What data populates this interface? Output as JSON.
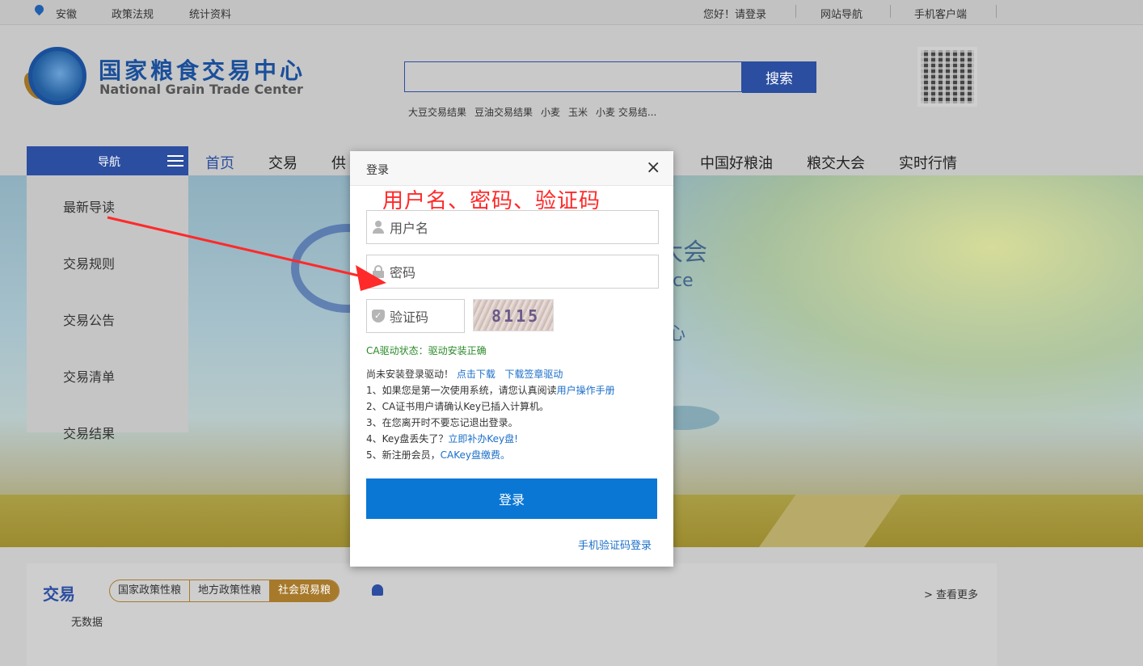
{
  "topbar": {
    "region": "安徽",
    "policy": "政策法规",
    "stats": "统计资料",
    "greeting": "您好！请登录",
    "site_nav": "网站导航",
    "mobile_client": "手机客户端"
  },
  "header": {
    "logo_cn": "国家粮食交易中心",
    "logo_en": "National Grain Trade Center",
    "search_placeholder": "",
    "search_button": "搜索",
    "hot_keywords": [
      "大豆交易结果",
      "豆油交易结果",
      "小麦",
      "玉米",
      "小麦 交易结..."
    ]
  },
  "nav": {
    "label": "导航",
    "tabs": [
      "首页",
      "交易",
      "供",
      "中国好粮油",
      "粮交大会",
      "实时行情"
    ]
  },
  "sidebar": {
    "items": [
      "最新导读",
      "交易规则",
      "交易公告",
      "交易清单",
      "交易结果"
    ]
  },
  "banner": {
    "text_fragments": [
      "大会",
      "ce",
      "心"
    ]
  },
  "bottom": {
    "title": "交易",
    "filters": [
      "国家政策性粮",
      "地方政策性粮",
      "社会贸易粮"
    ],
    "active_filter": "社会贸易粮",
    "more": "> 查看更多",
    "no_data": "无数据"
  },
  "modal": {
    "title": "登录",
    "annotation": "用户名、密码、验证码",
    "username_placeholder": "用户名",
    "password_placeholder": "密码",
    "captcha_placeholder": "验证码",
    "captcha_text": "8115",
    "ca_status": "CA驱动状态：驱动安装正确",
    "driver_prefix": "尚未安装登录驱动！",
    "driver_link1": "点击下载",
    "driver_link2": "下载签章驱动",
    "line1_text": "1、如果您是第一次使用系统，请您认真阅读",
    "line1_link": "用户操作手册",
    "line2": "2、CA证书用户请确认Key已插入计算机。",
    "line3": "3、在您离开时不要忘记退出登录。",
    "line4_text": "4、Key盘丢失了？",
    "line4_link": "立即补办Key盘!",
    "line5_text": "5、新注册会员，",
    "line5_link": "CAKey盘缴费。",
    "login_button": "登录",
    "sms_login": "手机验证码登录"
  },
  "colors": {
    "brand_blue": "#2c4ea0",
    "login_blue": "#0a77d5",
    "annotation_red": "#ff2a2a",
    "link_blue": "#1b6fc9",
    "status_green": "#2a8a2a",
    "gold": "#a7792b"
  }
}
